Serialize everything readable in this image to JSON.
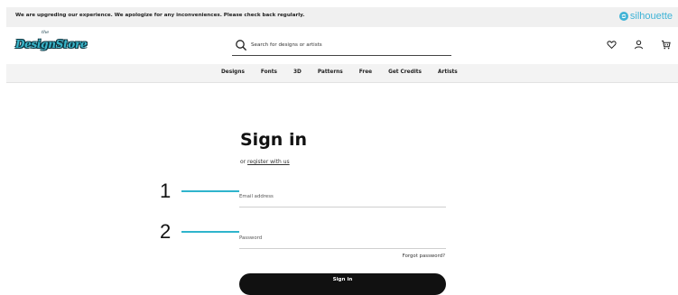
{
  "banner": {
    "text": "We are upgreding our experience. We apologize for any inconveniences. Please check back regularly.",
    "brand": "silhouette",
    "brand_color": "#3fb3d6",
    "brand_icon": "silhouette-logo-icon"
  },
  "header": {
    "logo_text": "DesignStore",
    "logo_small": "the",
    "logo_colors": {
      "fill": "#3ab5c9",
      "outline": "#0b3440"
    },
    "search": {
      "placeholder": "Search for designs or artists",
      "icon": "search-icon"
    },
    "icons": [
      "heart-icon",
      "user-icon",
      "cart-icon"
    ]
  },
  "nav": {
    "items": [
      "Designs",
      "Fonts",
      "3D",
      "Patterns",
      "Free",
      "Get Credits",
      "Artists"
    ]
  },
  "signin": {
    "title": "Sign in",
    "register_prefix": "or ",
    "register_link": "register with us",
    "email_placeholder": "Email address",
    "password_placeholder": "Password",
    "forgot": "Forgot password?",
    "button": "Sign in"
  },
  "annotations": {
    "items": [
      "1",
      "2"
    ],
    "line_color": "#2fb4cc"
  }
}
